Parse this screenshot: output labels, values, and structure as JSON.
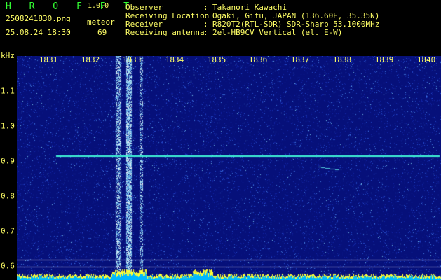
{
  "header": {
    "app_title": "H R O F F T",
    "version": "1.0.0",
    "filename": "2508241830.png",
    "meteor_label": "meteor",
    "datetime": "25.08.24 18:30",
    "meteor_count": "69"
  },
  "info": [
    {
      "label": "Observer",
      "value": "Takanori Kawachi"
    },
    {
      "label": "Receiving Location",
      "value": "Ogaki, Gifu, JAPAN (136.60E, 35.35N)"
    },
    {
      "label": "Receiver",
      "value": "R820T2(RTL-SDR) SDR-Sharp 53.1000MHz"
    },
    {
      "label": "Receiving antenna",
      "value": "2el-HB9CV Vertical (el. E-W)"
    }
  ],
  "info_separator": ":",
  "spectrogram": {
    "y_unit": "kHz",
    "x_ticks": [
      "1831",
      "1832",
      "1833",
      "1834",
      "1835",
      "1836",
      "1837",
      "1838",
      "1839",
      "1840"
    ],
    "y_ticks": [
      "1.1",
      "1.0",
      "0.9",
      "0.8",
      "0.7",
      "0.6"
    ],
    "colors": {
      "background": "#06107a",
      "trace": "#3ef0d6",
      "label": "#ffff66",
      "header_green": "#33ff33"
    }
  }
}
